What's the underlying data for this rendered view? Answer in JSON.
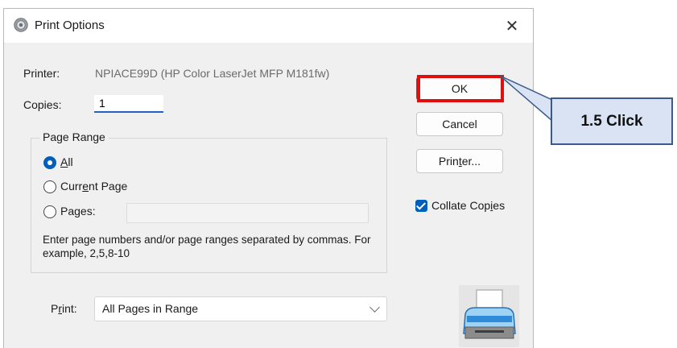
{
  "dialog": {
    "title": "Print Options",
    "close_symbol": "✕"
  },
  "printer": {
    "label": "Printer:",
    "value": "NPIACE99D (HP Color LaserJet MFP M181fw)"
  },
  "copies": {
    "label": "Copies:",
    "value": "1"
  },
  "page_range": {
    "legend": "Page Range",
    "options": [
      {
        "pre": "",
        "key": "A",
        "post": "ll",
        "checked": true
      },
      {
        "pre": "Curr",
        "key": "e",
        "post": "nt Page",
        "checked": false
      },
      {
        "pre": "Pa",
        "key": "g",
        "post": "es:",
        "checked": false
      }
    ],
    "pages_value": "",
    "help_text": "Enter page numbers and/or page ranges separated by commas. For example, 2,5,8-10"
  },
  "buttons": {
    "ok": "OK",
    "cancel": "Cancel",
    "printer": {
      "pre": "Prin",
      "key": "t",
      "post": "er..."
    }
  },
  "collate": {
    "pre": "Collate Cop",
    "key": "i",
    "post": "es",
    "checked": true
  },
  "print_select": {
    "label_pre": "P",
    "label_key": "r",
    "label_post": "int:",
    "value": "All Pages in Range"
  },
  "annotation": {
    "text": "1.5 Click",
    "highlight_color": "#e10e0e",
    "callout_fill": "#dae3f3",
    "callout_border": "#3a5b8a"
  },
  "icons": {
    "title": "gear-icon",
    "close": "close-icon",
    "printer": "printer-icon",
    "select": "chevron-down-icon",
    "checkbox": "checkmark-icon"
  },
  "colors": {
    "accent": "#005fb8",
    "focus_underline": "#2361c3",
    "dialog_bg": "#f0f0f0"
  }
}
